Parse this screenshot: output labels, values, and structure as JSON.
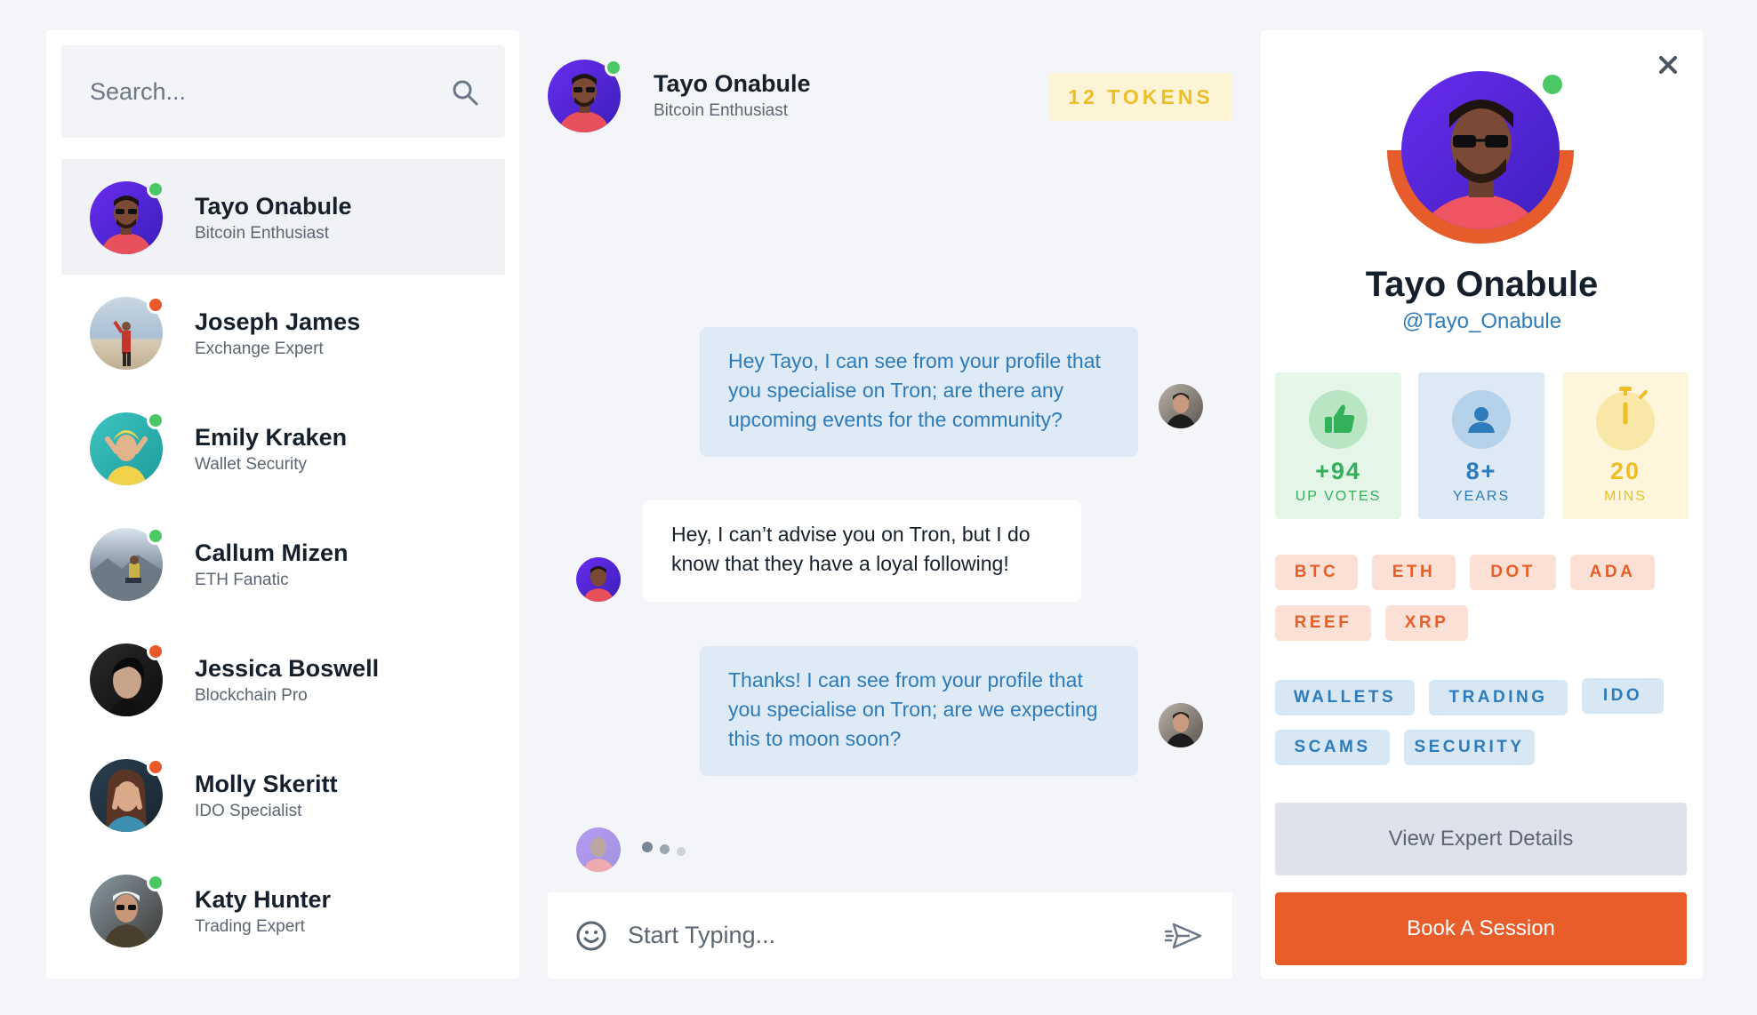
{
  "search": {
    "placeholder": "Search..."
  },
  "contacts": [
    {
      "name": "Tayo Onabule",
      "role": "Bitcoin Enthusiast",
      "status": "online"
    },
    {
      "name": "Joseph James",
      "role": "Exchange Expert",
      "status": "busy"
    },
    {
      "name": "Emily Kraken",
      "role": "Wallet Security",
      "status": "online"
    },
    {
      "name": "Callum Mizen",
      "role": "ETH Fanatic",
      "status": "online"
    },
    {
      "name": "Jessica Boswell",
      "role": "Blockchain Pro",
      "status": "busy"
    },
    {
      "name": "Molly Skeritt",
      "role": "IDO Specialist",
      "status": "busy"
    },
    {
      "name": "Katy Hunter",
      "role": "Trading Expert",
      "status": "online"
    }
  ],
  "chat": {
    "header": {
      "name": "Tayo Onabule",
      "role": "Bitcoin Enthusiast",
      "tokens": "12 TOKENS"
    },
    "messages": [
      {
        "direction": "outgoing",
        "text": "Hey Tayo, I can see from your profile that you specialise on Tron; are there any upcoming events for the community?"
      },
      {
        "direction": "incoming",
        "text": "Hey, I can’t advise you on Tron, but I do know that they have a loyal following!"
      },
      {
        "direction": "outgoing",
        "text": "Thanks! I can see from your profile that you specialise on Tron; are we expecting this to moon soon?"
      }
    ],
    "composer": {
      "placeholder": "Start Typing..."
    }
  },
  "profile": {
    "name": "Tayo Onabule",
    "handle": "@Tayo_Onabule",
    "stats": [
      {
        "value": "+94",
        "label": "UP VOTES",
        "icon": "thumbs-up-icon"
      },
      {
        "value": "8+",
        "label": "YEARS",
        "icon": "user-icon"
      },
      {
        "value": "20",
        "label": "MINS",
        "icon": "stopwatch-icon"
      }
    ],
    "coins": [
      "BTC",
      "ETH",
      "DOT",
      "ADA",
      "REEF",
      "XRP"
    ],
    "topics": [
      "WALLETS",
      "TRADING",
      "IDO",
      "SCAMS",
      "SECURITY"
    ],
    "view_details_label": "View Expert Details",
    "book_label": "Book A Session"
  },
  "colors": {
    "online": "#4cc766",
    "busy": "#e8582a",
    "accent": "#e85d2a",
    "link": "#2e7bbb",
    "tokens": "#ecbf28"
  }
}
